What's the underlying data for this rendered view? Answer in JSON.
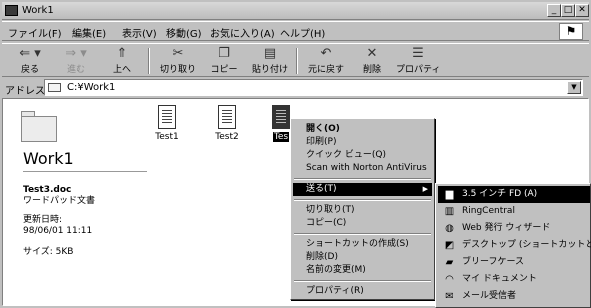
{
  "window": {
    "title": "Work1",
    "caption_buttons": {
      "minimize": "_",
      "maximize": "□",
      "close": "✕"
    }
  },
  "menubar": {
    "items": [
      "ファイル(F)",
      "編集(E)",
      "表示(V)",
      "移動(G)",
      "お気に入り(A)",
      "ヘルプ(H)"
    ]
  },
  "toolbar": {
    "buttons": [
      {
        "label": "戻る",
        "glyph": "⇐ ▾"
      },
      {
        "label": "進む",
        "glyph": "⇒ ▾"
      },
      {
        "label": "上へ",
        "glyph": "⇑"
      },
      {
        "label": "切り取り",
        "glyph": "✂"
      },
      {
        "label": "コピー",
        "glyph": "❐"
      },
      {
        "label": "貼り付け",
        "glyph": "▤"
      },
      {
        "label": "元に戻す",
        "glyph": "↶"
      },
      {
        "label": "削除",
        "glyph": "✕"
      },
      {
        "label": "プロパティ",
        "glyph": "☰"
      }
    ]
  },
  "addressbar": {
    "label": "アドレス",
    "value": "C:¥Work1",
    "dropdown": "▼"
  },
  "content": {
    "folder_title": "Work1",
    "selected_file": {
      "name": "Test3.doc",
      "type": "ワードパッド文書",
      "modified_label": "更新日時:",
      "modified_value": "98/06/01 11:11",
      "size": "サイズ: 5KB"
    },
    "files": [
      {
        "name": "Test1"
      },
      {
        "name": "Test2"
      },
      {
        "name": "Tes"
      }
    ]
  },
  "context_menu": {
    "items": {
      "open": "開く(O)",
      "print": "印刷(P)",
      "quick_view": "クイック ビュー(Q)",
      "scan": "Scan with Norton AntiVirus",
      "send_to": "送る(T)",
      "cut": "切り取り(T)",
      "copy": "コピー(C)",
      "create_shortcut": "ショートカットの作成(S)",
      "delete": "削除(D)",
      "rename": "名前の変更(M)",
      "properties": "プロパティ(R)"
    },
    "submenu_arrow": "▶"
  },
  "send_to_menu": {
    "items": [
      {
        "label": "3.5 インチ FD (A)",
        "icon": "▆"
      },
      {
        "label": "RingCentral",
        "icon": "▥"
      },
      {
        "label": "Web 発行 ウィザード",
        "icon": "◍"
      },
      {
        "label": "デスクトップ (ショートカットとして)",
        "icon": "◩"
      },
      {
        "label": "ブリーフケース",
        "icon": "▰"
      },
      {
        "label": "マイ ドキュメント",
        "icon": "◠"
      },
      {
        "label": "メール受信者",
        "icon": "✉"
      }
    ]
  },
  "colors": {
    "chrome": "#c0c0c0",
    "highlight": "#000000",
    "highlight_text": "#ffffff"
  }
}
